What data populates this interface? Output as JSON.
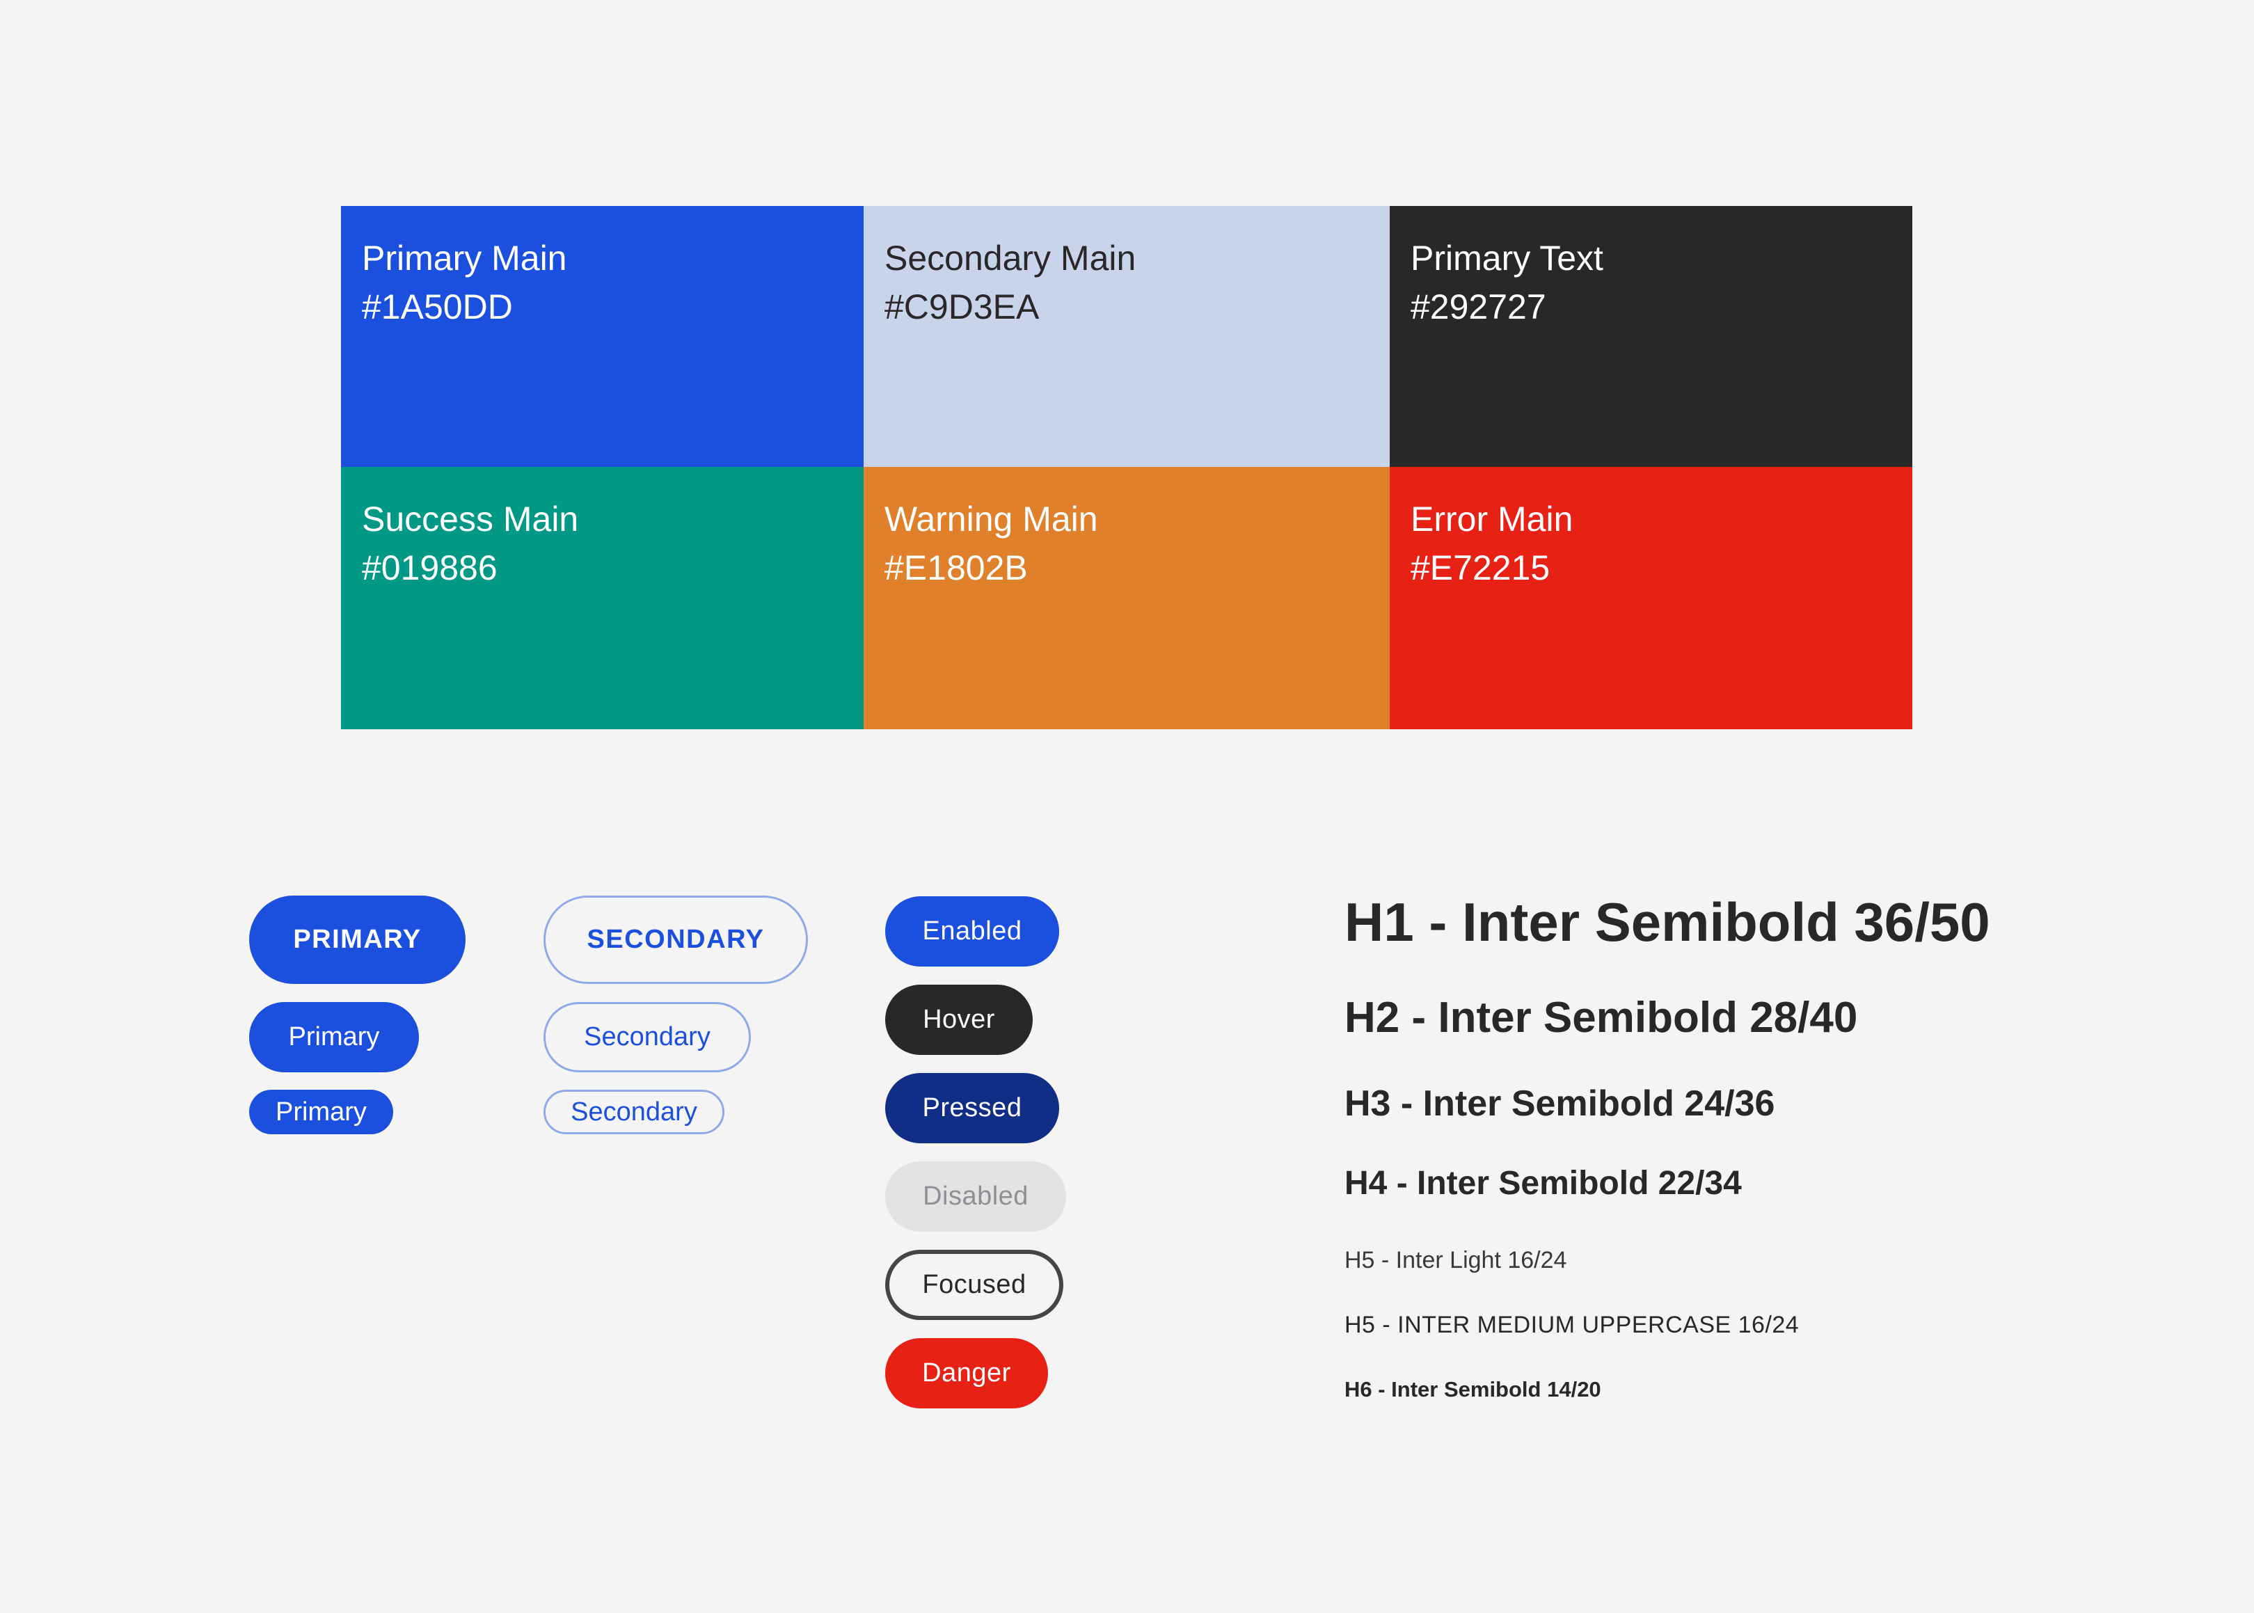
{
  "palette": [
    {
      "name": "Primary Main",
      "hex": "#1A50DD",
      "bg": "#1a50dd",
      "fg": "#ffffff"
    },
    {
      "name": "Secondary Main",
      "hex": "#C9D3EA",
      "bg": "#c9d3ea",
      "fg": "#292727"
    },
    {
      "name": "Primary Text",
      "hex": "#292727",
      "bg": "#292727",
      "fg": "#ffffff"
    },
    {
      "name": "Success Main",
      "hex": "#019886",
      "bg": "#019886",
      "fg": "#ffffff"
    },
    {
      "name": "Warning Main",
      "hex": "#E1802B",
      "bg": "#e1802b",
      "fg": "#ffffff"
    },
    {
      "name": "Error Main",
      "hex": "#E72215",
      "bg": "#e72215",
      "fg": "#ffffff"
    }
  ],
  "buttons": {
    "primary": {
      "large": "PRIMARY",
      "medium": "Primary",
      "small": "Primary"
    },
    "secondary": {
      "large": "SECONDARY",
      "medium": "Secondary",
      "small": "Secondary"
    },
    "states": {
      "enabled": "Enabled",
      "hover": "Hover",
      "pressed": "Pressed",
      "disabled": "Disabled",
      "focused": "Focused",
      "danger": "Danger"
    }
  },
  "typography": {
    "h1": "H1 - Inter Semibold 36/50",
    "h2": "H2 - Inter Semibold 28/40",
    "h3": "H3 - Inter Semibold 24/36",
    "h4": "H4 - Inter Semibold 22/34",
    "h5_light": "H5 - Inter Light 16/24",
    "h5_medium": "H5 - INTER MEDIUM UPPERCASE 16/24",
    "h6": "H6 - Inter Semibold 14/20"
  }
}
